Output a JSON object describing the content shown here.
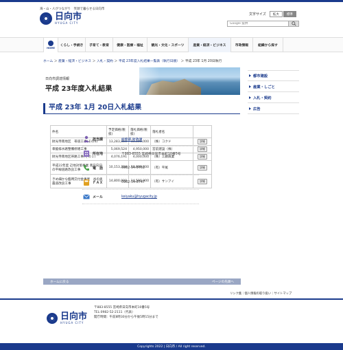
{
  "header": {
    "tagline": "海・山・人がつながり　笑顔で暮らせる日向市",
    "logo_name": "日向市",
    "logo_sub": "HYUGA CITY",
    "fontsize_label": "文字サイズ",
    "fontsize_large": "拡大",
    "fontsize_normal": "標準",
    "search_placeholder": "Google 提供"
  },
  "gnav": {
    "home": "HOME",
    "items": [
      "くらし・手続き",
      "子育て・教育",
      "健康・医療・福祉",
      "観光・文化・スポーツ",
      "産業・経済・ビジネス",
      "市政情報",
      "組織から探す"
    ]
  },
  "breadcrumb": {
    "items": [
      "ホーム",
      "産業・経済・ビジネス",
      "入札・契約",
      "平成 23年度入札結果一覧表（執行日順）"
    ],
    "current": "平成 23年 1月 20日執行"
  },
  "banner": {
    "small": "日向市調達情報",
    "title": "平成 23年度入札結果"
  },
  "page_title": "平成 23年 1月 20日入札結果",
  "table": {
    "headers": [
      "件名",
      "予定価格(税抜)",
      "落札価格(税抜)",
      "落札者名",
      ""
    ],
    "rows": [
      {
        "name": "財光寺南地区　帯道工事(その4)",
        "estimate": "13,283,810",
        "award": "13,100,000",
        "winner": "（株）コクド",
        "detail": "詳細"
      },
      {
        "name": "幸脇排水路整備修繕工事",
        "estimate": "5,069,524",
        "award": "4,950,000",
        "winner": "宮前建設（株）",
        "detail": "詳細"
      },
      {
        "name": "財光寺南地区帯路工事(その１)",
        "estimate": "4,076,191",
        "award": "4,000,000",
        "winner": "（株）工藤興業",
        "detail": "詳細"
      },
      {
        "name": "平成22年度 辺地対策事業 南日向日の平線道路改良工事",
        "estimate": "10,153,334",
        "award": "10,080,000",
        "winner": "（有）平尾",
        "detail": "詳細"
      },
      {
        "name": "きめ細かな臨時交付金事業　谷の奥農道改良工事",
        "estimate": "14,800,000",
        "award": "14,580,000",
        "winner": "（有）サンアイ",
        "detail": "詳細"
      }
    ]
  },
  "contact": {
    "dept_label": "担当課",
    "dept_value": "総務部 財政課",
    "address_label": "所在地",
    "address_value": "〒883-8555 宮崎県日向市本町10番5号",
    "phone_label": "電　話",
    "phone_value": "0982-54-5761",
    "fax_label": "ＦＡＸ",
    "fax_value": "0982-54-8747",
    "mail_label": "メール",
    "mail_value": "keiyaku@hyugacity.jp"
  },
  "pagenav": {
    "back": "ホームに戻る",
    "top": "ページの先頭へ"
  },
  "footer": {
    "links": "リンク集｜個人情報の取り扱い｜サイトマップ",
    "address1": "〒883-8555 宮崎県日向市本町10番5号",
    "tel": "TEL:0982-52-2111（代表）",
    "hours": "開庁時間：午前8時30分から午後5時15分まで",
    "copyright": "Copyrights 2022 | 日向市 / All right reserved."
  },
  "side": {
    "items": [
      "都市建設",
      "産業・しごと",
      "入札・契約",
      "広告"
    ]
  },
  "colors": {
    "brand": "#1a3a8c",
    "nav_bar": "#9aa7c4"
  }
}
